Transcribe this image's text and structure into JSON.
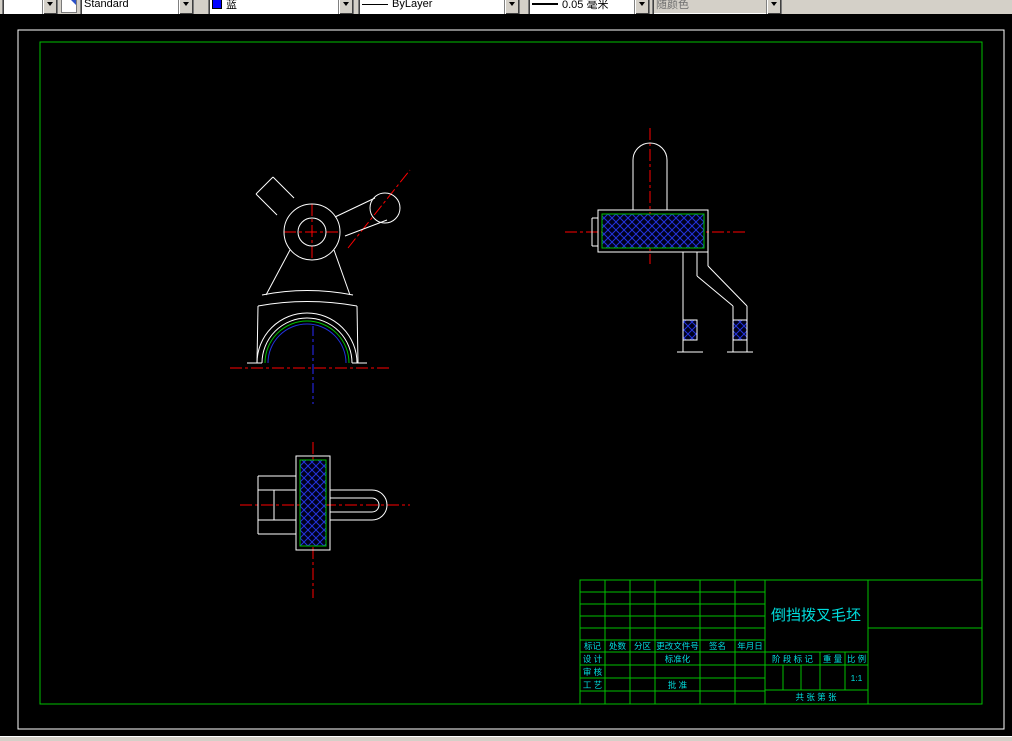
{
  "toolbar": {
    "workspace_combo": {
      "value": ""
    },
    "style_combo": {
      "value": "Standard"
    },
    "layer_combo": {
      "value": "蓝",
      "swatch_color": "#0000ff"
    },
    "linetype_combo": {
      "value": "ByLayer"
    },
    "lineweight_combo": {
      "value": "0.05 毫米"
    },
    "plotstyle_combo": {
      "value": "随颜色"
    }
  },
  "drawing": {
    "views": [
      "front-view",
      "side-view",
      "top-view"
    ],
    "colors": {
      "outline_white": "#ffffff",
      "centerline_red": "#ff0000",
      "centerline_blue": "#2a2aff",
      "hatch_blue": "#2233dd",
      "frame_green": "#00c000",
      "titleblock_text_cyan": "#00dede"
    }
  },
  "title_block": {
    "part_name": "倒挡拨叉毛坯",
    "revision_header": [
      "标记",
      "处数",
      "分区",
      "更改文件号",
      "签名",
      "年月日"
    ],
    "roles": {
      "design": "设 计",
      "standardization": "标准化",
      "check": "审 核",
      "process": "工 艺",
      "approve": "批 准"
    },
    "fields": {
      "stage_mark": "阶 段 标 记",
      "weight": "重 量",
      "scale": "比 例",
      "scale_value": "1:1",
      "sheet_info": "共  张  第  张"
    }
  }
}
